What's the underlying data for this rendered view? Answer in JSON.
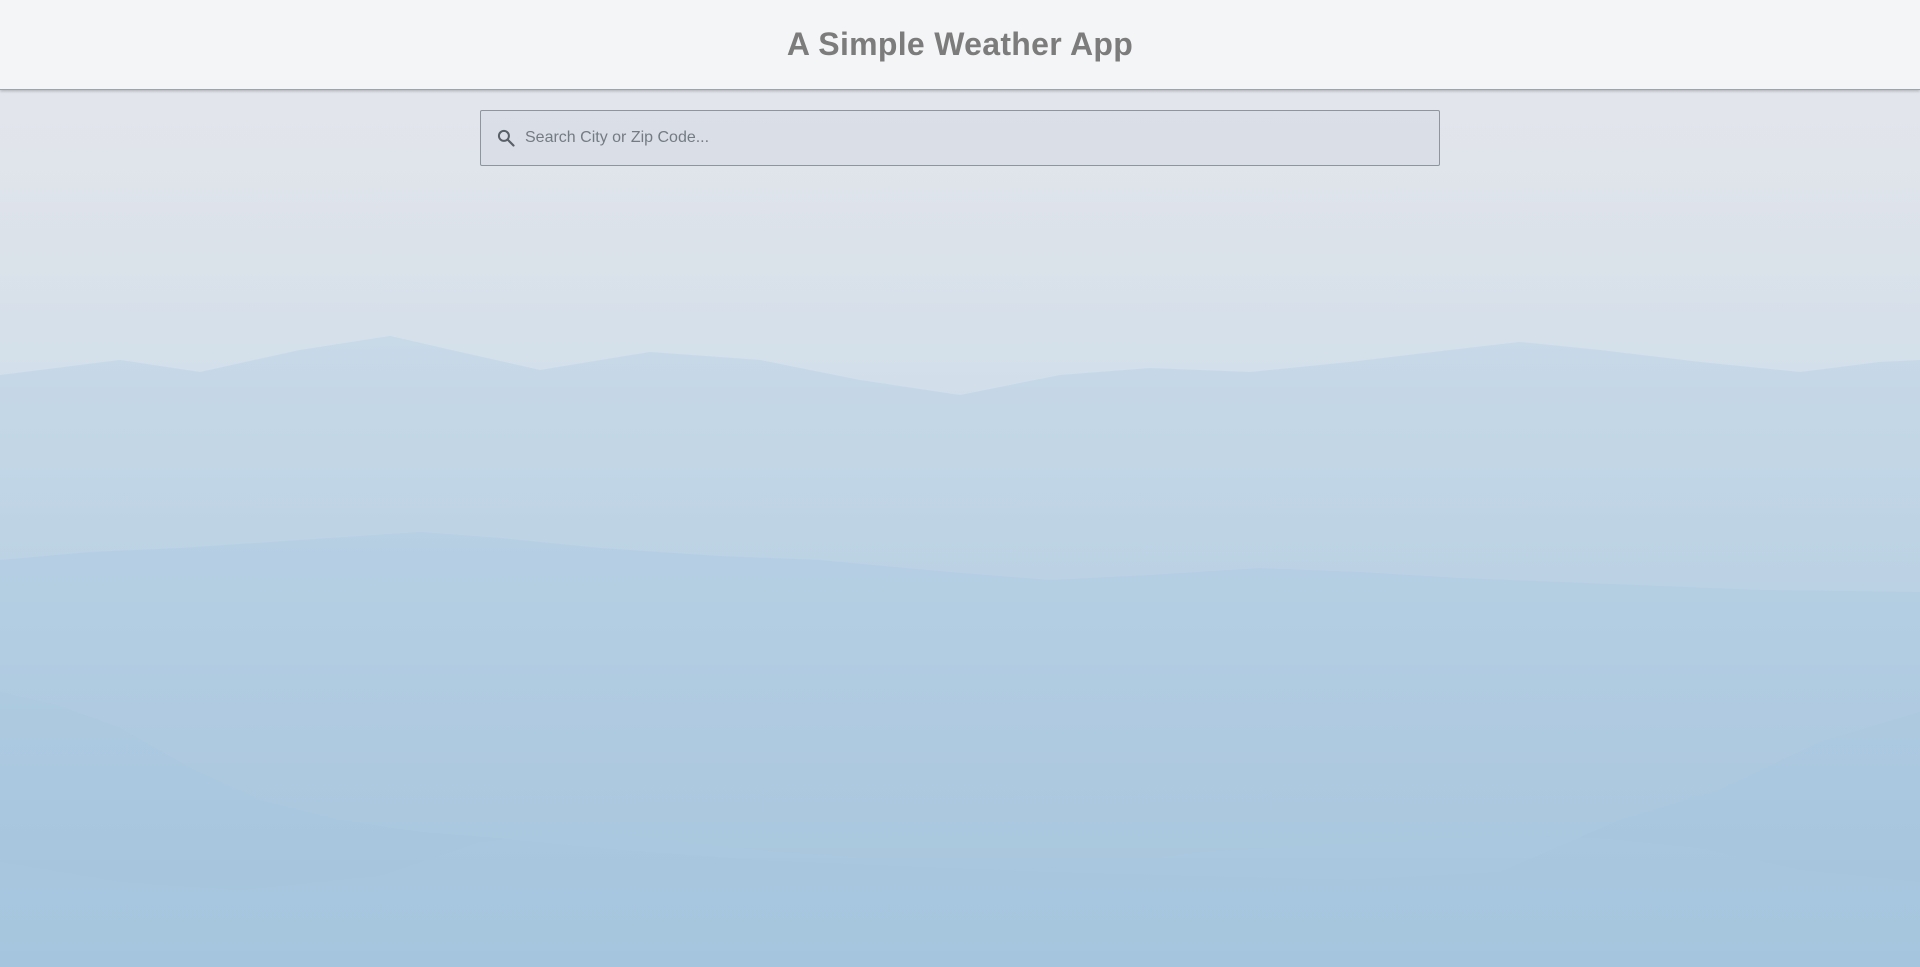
{
  "header": {
    "title": "A Simple Weather App"
  },
  "search": {
    "placeholder": "Search City or Zip Code...",
    "value": "",
    "icon": "search-icon"
  },
  "colors": {
    "header_background": "#f4f5f7",
    "title_text": "#7c7c7c",
    "sky_top": "#d9dbe4",
    "sky_bottom": "#acc9e0"
  }
}
